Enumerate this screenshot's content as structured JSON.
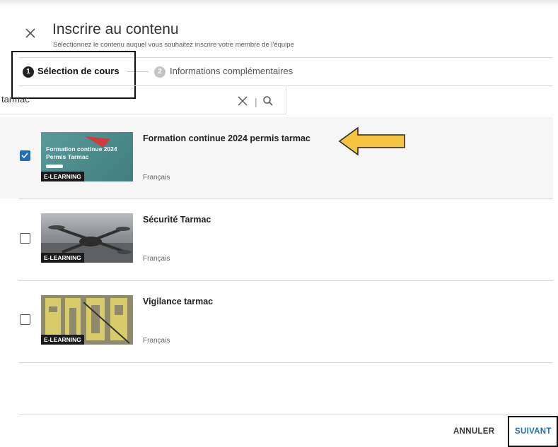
{
  "dialog": {
    "title": "Inscrire au contenu",
    "subtitle": "Sélectionnez le contenu auquel vous souhaitez inscrire votre membre de l'équipe"
  },
  "stepper": {
    "steps": [
      {
        "number": "1",
        "label": "Sélection de cours"
      },
      {
        "number": "2",
        "label": "Informations complémentaires"
      }
    ]
  },
  "search": {
    "value": "tarmac"
  },
  "courses": [
    {
      "title": "Formation continue 2024 permis tarmac",
      "language": "Français",
      "badge": "E-LEARNING",
      "checked": true,
      "thumb_caption_1": "Formation continue 2024",
      "thumb_caption_2": "Permis Tarmac"
    },
    {
      "title": "Sécurité Tarmac",
      "language": "Français",
      "badge": "E-LEARNING",
      "checked": false
    },
    {
      "title": "Vigilance tarmac",
      "language": "Français",
      "badge": "E-LEARNING",
      "checked": false
    }
  ],
  "footer": {
    "cancel_label": "ANNULER",
    "next_label": "SUIVANT"
  },
  "colors": {
    "accent": "#1d70b5",
    "divider": "#e8d6cf",
    "annotation_arrow": "#f5c542"
  }
}
